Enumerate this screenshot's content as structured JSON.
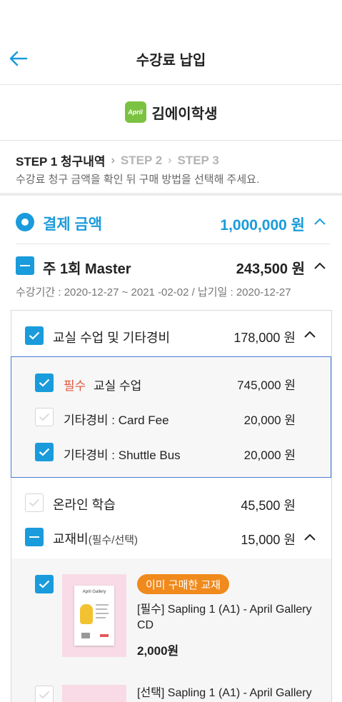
{
  "header": {
    "title": "수강료 납입"
  },
  "brand": {
    "logo_text": "April",
    "student_name": "김에이학생"
  },
  "steps": {
    "step1": "STEP 1 청구내역",
    "step2": "STEP 2",
    "step3": "STEP 3",
    "description": "수강료 청구 금액을 확인 뒤 구매 방법을 선택해 주세요."
  },
  "payment": {
    "label": "결제 금액",
    "amount": "1,000,000 원"
  },
  "course": {
    "title": "주 1회 Master",
    "amount": "243,500 원",
    "period": "수강기간 : 2020-12-27 ~ 2021 -02-02  /  납기일 : 2020-12-27"
  },
  "classroom": {
    "label": "교실 수업 및 기타경비",
    "amount": "178,000 원",
    "items": [
      {
        "tag": "필수",
        "label": "교실 수업",
        "amount": "745,000 원",
        "checked": true
      },
      {
        "tag": "",
        "label": "기타경비 : Card Fee",
        "amount": "20,000 원",
        "checked": false
      },
      {
        "tag": "",
        "label": "기타경비 : Shuttle Bus",
        "amount": "20,000 원",
        "checked": true
      }
    ]
  },
  "online": {
    "label": "온라인 학습",
    "amount": "45,500 원"
  },
  "textbook": {
    "label": "교재비",
    "label_sub": "(필수/선택)",
    "amount": "15,000 원"
  },
  "products": [
    {
      "badge": "이미 구매한 교재",
      "title": "[필수] Sapling 1 (A1) - April Gallery CD",
      "price": "2,000원",
      "book_text": "April Gallery"
    },
    {
      "title": "[선택] Sapling 1 (A1) - April Gallery"
    }
  ],
  "colors": {
    "accent": "#1a9bdb",
    "required": "#e2533b",
    "badge": "#f08a1c",
    "logo": "#7cc242"
  }
}
